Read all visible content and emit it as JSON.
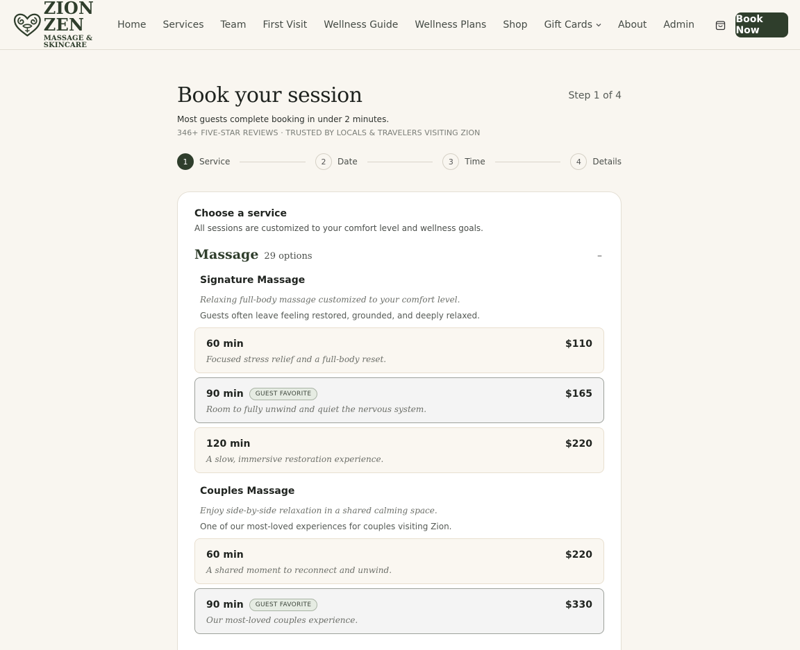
{
  "brand": {
    "title": "ZION ZEN",
    "subtitle": "MASSAGE & SKINCARE"
  },
  "nav": {
    "items": [
      "Home",
      "Services",
      "Team",
      "First Visit",
      "Wellness Guide",
      "Wellness Plans",
      "Shop",
      "Gift Cards",
      "About",
      "Admin"
    ],
    "book_label": "Book Now"
  },
  "page": {
    "title": "Book your session",
    "step_text": "Step 1 of 4",
    "subtitle": "Most guests complete booking in under 2 minutes.",
    "reviews": "346+ FIVE-STAR REVIEWS · TRUSTED BY LOCALS & TRAVELERS VISITING ZION"
  },
  "steps": [
    {
      "num": "1",
      "label": "Service"
    },
    {
      "num": "2",
      "label": "Date"
    },
    {
      "num": "3",
      "label": "Time"
    },
    {
      "num": "4",
      "label": "Details"
    }
  ],
  "card": {
    "title": "Choose a service",
    "subtitle": "All sessions are customized to your comfort level and wellness goals.",
    "category": {
      "name": "Massage",
      "count": "29 options",
      "collapse": "–"
    },
    "services": [
      {
        "name": "Signature Massage",
        "desc": "Relaxing full-body massage customized to your comfort level.",
        "note": "Guests often leave feeling restored, grounded, and deeply relaxed.",
        "options": [
          {
            "duration": "60 min",
            "price": "$110",
            "desc": "Focused stress relief and a full-body reset."
          },
          {
            "duration": "90 min",
            "price": "$165",
            "desc": "Room to fully unwind and quiet the nervous system.",
            "badge": "GUEST FAVORITE"
          },
          {
            "duration": "120 min",
            "price": "$220",
            "desc": "A slow, immersive restoration experience."
          }
        ]
      },
      {
        "name": "Couples Massage",
        "desc": "Enjoy side-by-side relaxation in a shared calming space.",
        "note": "One of our most-loved experiences for couples visiting Zion.",
        "options": [
          {
            "duration": "60 min",
            "price": "$220",
            "desc": "A shared moment to reconnect and unwind."
          },
          {
            "duration": "90 min",
            "price": "$330",
            "desc": "Our most-loved couples experience.",
            "badge": "GUEST FAVORITE"
          }
        ]
      }
    ]
  },
  "colors": {
    "brand_green": "#2f3e2c",
    "background": "#f9f6f0",
    "card": "#ffffff"
  },
  "icons": {
    "cart": "shopping-bag-icon",
    "dropdown": "chevron-down-icon"
  }
}
